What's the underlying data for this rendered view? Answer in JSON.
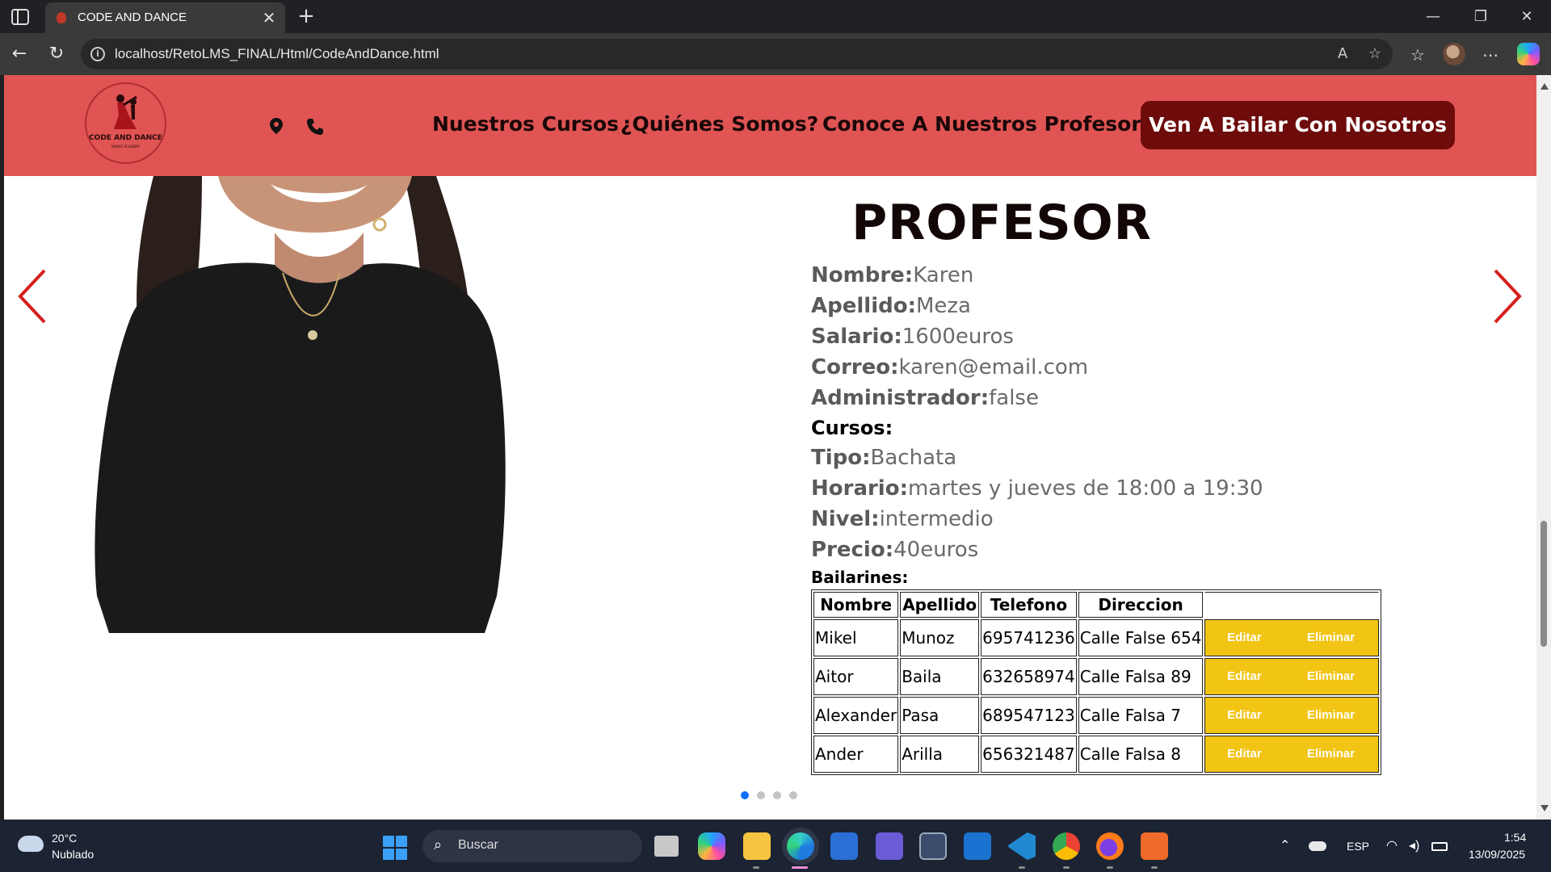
{
  "browser": {
    "tab_title": "CODE AND DANCE",
    "url": "localhost/RetoLMS_FINAL/Html/CodeAndDance.html"
  },
  "site": {
    "logo_text": "CODE AND DANCE",
    "logo_subtext": "DANCE ACADEMY",
    "nav": [
      "Nuestros Cursos",
      "¿Quiénes Somos?",
      "Conoce A Nuestros Profesores"
    ],
    "cta": "Ven A Bailar Con Nosotros",
    "header_color": "#e05454",
    "cta_color": "#6e0b0b"
  },
  "profesor": {
    "title": "PROFESOR",
    "fields": [
      {
        "label": "Nombre:",
        "value": "Karen"
      },
      {
        "label": "Apellido:",
        "value": "Meza"
      },
      {
        "label": "Salario:",
        "value": "1600euros"
      },
      {
        "label": "Correo:",
        "value": "karen@email.com"
      },
      {
        "label": "Administrador:",
        "value": "false"
      }
    ],
    "cursos_label": "Cursos:",
    "curso_fields": [
      {
        "label": "Tipo:",
        "value": "Bachata"
      },
      {
        "label": "Horario:",
        "value": "martes y jueves de 18:00 a 19:30"
      },
      {
        "label": "Nivel:",
        "value": "intermedio"
      },
      {
        "label": "Precio:",
        "value": "40euros"
      }
    ],
    "bailarines_label": "Bailarines:"
  },
  "table": {
    "headers": [
      "Nombre",
      "Apellido",
      "Telefono",
      "Direccion"
    ],
    "rows": [
      [
        "Mikel",
        "Munoz",
        "695741236",
        "Calle False 654"
      ],
      [
        "Aitor",
        "Baila",
        "632658974",
        "Calle Falsa 89"
      ],
      [
        "Alexander",
        "Pasa",
        "689547123",
        "Calle Falsa 7"
      ],
      [
        "Ander",
        "Arilla",
        "656321487",
        "Calle Falsa 8"
      ]
    ],
    "edit_label": "Editar",
    "delete_label": "Eliminar",
    "action_color": "#f2c413"
  },
  "carousel": {
    "slide_count": 4,
    "active_index": 0
  },
  "taskbar": {
    "temp": "20°C",
    "weather": "Nublado",
    "search_placeholder": "Buscar",
    "lang": "ESP",
    "time": "1:54",
    "date": "13/09/2025"
  }
}
